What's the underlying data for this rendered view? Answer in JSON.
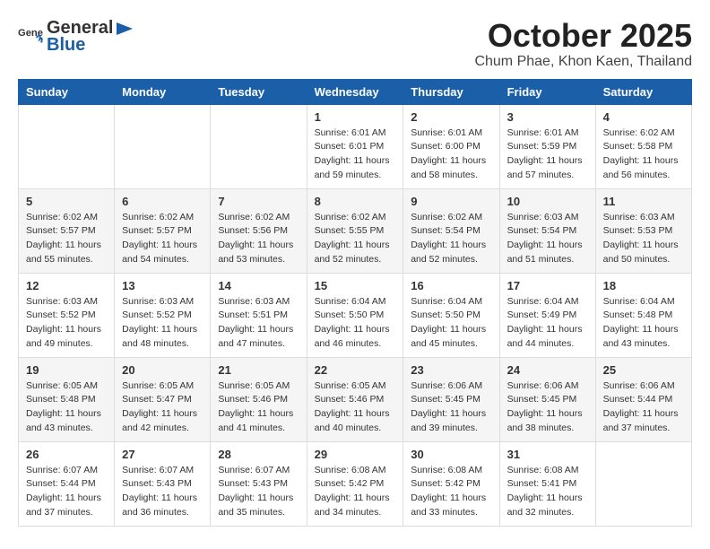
{
  "header": {
    "logo_general": "General",
    "logo_blue": "Blue",
    "title": "October 2025",
    "subtitle": "Chum Phae, Khon Kaen, Thailand"
  },
  "weekdays": [
    "Sunday",
    "Monday",
    "Tuesday",
    "Wednesday",
    "Thursday",
    "Friday",
    "Saturday"
  ],
  "weeks": [
    [
      {
        "day": "",
        "sunrise": "",
        "sunset": "",
        "daylight": ""
      },
      {
        "day": "",
        "sunrise": "",
        "sunset": "",
        "daylight": ""
      },
      {
        "day": "",
        "sunrise": "",
        "sunset": "",
        "daylight": ""
      },
      {
        "day": "1",
        "sunrise": "Sunrise: 6:01 AM",
        "sunset": "Sunset: 6:01 PM",
        "daylight": "Daylight: 11 hours and 59 minutes."
      },
      {
        "day": "2",
        "sunrise": "Sunrise: 6:01 AM",
        "sunset": "Sunset: 6:00 PM",
        "daylight": "Daylight: 11 hours and 58 minutes."
      },
      {
        "day": "3",
        "sunrise": "Sunrise: 6:01 AM",
        "sunset": "Sunset: 5:59 PM",
        "daylight": "Daylight: 11 hours and 57 minutes."
      },
      {
        "day": "4",
        "sunrise": "Sunrise: 6:02 AM",
        "sunset": "Sunset: 5:58 PM",
        "daylight": "Daylight: 11 hours and 56 minutes."
      }
    ],
    [
      {
        "day": "5",
        "sunrise": "Sunrise: 6:02 AM",
        "sunset": "Sunset: 5:57 PM",
        "daylight": "Daylight: 11 hours and 55 minutes."
      },
      {
        "day": "6",
        "sunrise": "Sunrise: 6:02 AM",
        "sunset": "Sunset: 5:57 PM",
        "daylight": "Daylight: 11 hours and 54 minutes."
      },
      {
        "day": "7",
        "sunrise": "Sunrise: 6:02 AM",
        "sunset": "Sunset: 5:56 PM",
        "daylight": "Daylight: 11 hours and 53 minutes."
      },
      {
        "day": "8",
        "sunrise": "Sunrise: 6:02 AM",
        "sunset": "Sunset: 5:55 PM",
        "daylight": "Daylight: 11 hours and 52 minutes."
      },
      {
        "day": "9",
        "sunrise": "Sunrise: 6:02 AM",
        "sunset": "Sunset: 5:54 PM",
        "daylight": "Daylight: 11 hours and 52 minutes."
      },
      {
        "day": "10",
        "sunrise": "Sunrise: 6:03 AM",
        "sunset": "Sunset: 5:54 PM",
        "daylight": "Daylight: 11 hours and 51 minutes."
      },
      {
        "day": "11",
        "sunrise": "Sunrise: 6:03 AM",
        "sunset": "Sunset: 5:53 PM",
        "daylight": "Daylight: 11 hours and 50 minutes."
      }
    ],
    [
      {
        "day": "12",
        "sunrise": "Sunrise: 6:03 AM",
        "sunset": "Sunset: 5:52 PM",
        "daylight": "Daylight: 11 hours and 49 minutes."
      },
      {
        "day": "13",
        "sunrise": "Sunrise: 6:03 AM",
        "sunset": "Sunset: 5:52 PM",
        "daylight": "Daylight: 11 hours and 48 minutes."
      },
      {
        "day": "14",
        "sunrise": "Sunrise: 6:03 AM",
        "sunset": "Sunset: 5:51 PM",
        "daylight": "Daylight: 11 hours and 47 minutes."
      },
      {
        "day": "15",
        "sunrise": "Sunrise: 6:04 AM",
        "sunset": "Sunset: 5:50 PM",
        "daylight": "Daylight: 11 hours and 46 minutes."
      },
      {
        "day": "16",
        "sunrise": "Sunrise: 6:04 AM",
        "sunset": "Sunset: 5:50 PM",
        "daylight": "Daylight: 11 hours and 45 minutes."
      },
      {
        "day": "17",
        "sunrise": "Sunrise: 6:04 AM",
        "sunset": "Sunset: 5:49 PM",
        "daylight": "Daylight: 11 hours and 44 minutes."
      },
      {
        "day": "18",
        "sunrise": "Sunrise: 6:04 AM",
        "sunset": "Sunset: 5:48 PM",
        "daylight": "Daylight: 11 hours and 43 minutes."
      }
    ],
    [
      {
        "day": "19",
        "sunrise": "Sunrise: 6:05 AM",
        "sunset": "Sunset: 5:48 PM",
        "daylight": "Daylight: 11 hours and 43 minutes."
      },
      {
        "day": "20",
        "sunrise": "Sunrise: 6:05 AM",
        "sunset": "Sunset: 5:47 PM",
        "daylight": "Daylight: 11 hours and 42 minutes."
      },
      {
        "day": "21",
        "sunrise": "Sunrise: 6:05 AM",
        "sunset": "Sunset: 5:46 PM",
        "daylight": "Daylight: 11 hours and 41 minutes."
      },
      {
        "day": "22",
        "sunrise": "Sunrise: 6:05 AM",
        "sunset": "Sunset: 5:46 PM",
        "daylight": "Daylight: 11 hours and 40 minutes."
      },
      {
        "day": "23",
        "sunrise": "Sunrise: 6:06 AM",
        "sunset": "Sunset: 5:45 PM",
        "daylight": "Daylight: 11 hours and 39 minutes."
      },
      {
        "day": "24",
        "sunrise": "Sunrise: 6:06 AM",
        "sunset": "Sunset: 5:45 PM",
        "daylight": "Daylight: 11 hours and 38 minutes."
      },
      {
        "day": "25",
        "sunrise": "Sunrise: 6:06 AM",
        "sunset": "Sunset: 5:44 PM",
        "daylight": "Daylight: 11 hours and 37 minutes."
      }
    ],
    [
      {
        "day": "26",
        "sunrise": "Sunrise: 6:07 AM",
        "sunset": "Sunset: 5:44 PM",
        "daylight": "Daylight: 11 hours and 37 minutes."
      },
      {
        "day": "27",
        "sunrise": "Sunrise: 6:07 AM",
        "sunset": "Sunset: 5:43 PM",
        "daylight": "Daylight: 11 hours and 36 minutes."
      },
      {
        "day": "28",
        "sunrise": "Sunrise: 6:07 AM",
        "sunset": "Sunset: 5:43 PM",
        "daylight": "Daylight: 11 hours and 35 minutes."
      },
      {
        "day": "29",
        "sunrise": "Sunrise: 6:08 AM",
        "sunset": "Sunset: 5:42 PM",
        "daylight": "Daylight: 11 hours and 34 minutes."
      },
      {
        "day": "30",
        "sunrise": "Sunrise: 6:08 AM",
        "sunset": "Sunset: 5:42 PM",
        "daylight": "Daylight: 11 hours and 33 minutes."
      },
      {
        "day": "31",
        "sunrise": "Sunrise: 6:08 AM",
        "sunset": "Sunset: 5:41 PM",
        "daylight": "Daylight: 11 hours and 32 minutes."
      },
      {
        "day": "",
        "sunrise": "",
        "sunset": "",
        "daylight": ""
      }
    ]
  ]
}
